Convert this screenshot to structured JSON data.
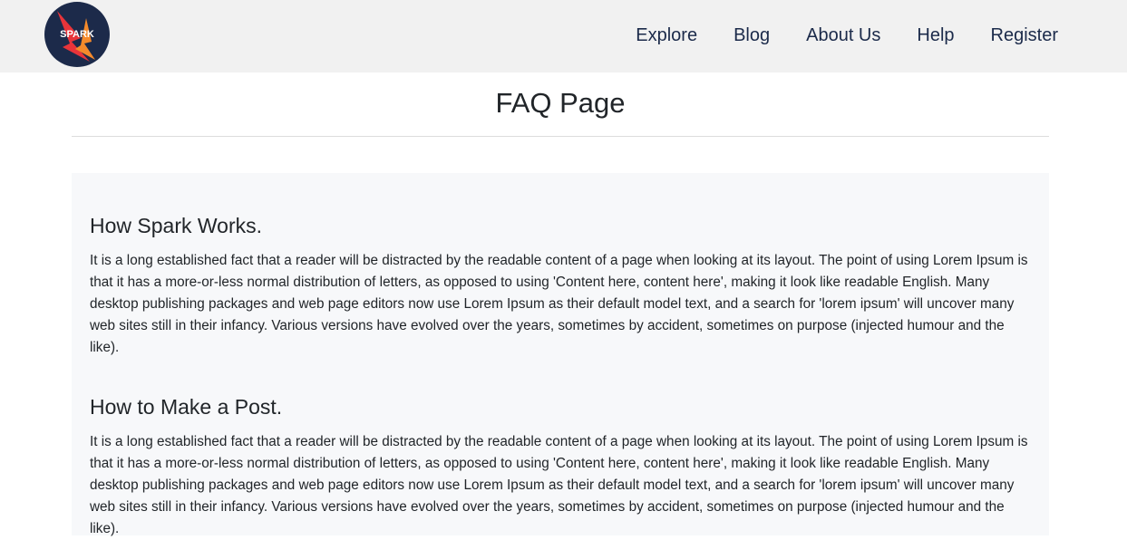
{
  "header": {
    "logo_text": "SPARK",
    "nav": [
      {
        "label": "Explore"
      },
      {
        "label": "Blog"
      },
      {
        "label": "About Us"
      },
      {
        "label": "Help"
      },
      {
        "label": "Register"
      }
    ]
  },
  "page": {
    "title": "FAQ Page"
  },
  "faq": [
    {
      "question": "How Spark Works.",
      "answer": "It is a long established fact that a reader will be distracted by the readable content of a page when looking at its layout. The point of using Lorem Ipsum is that it has a more-or-less normal distribution of letters, as opposed to using 'Content here, content here', making it look like readable English. Many desktop publishing packages and web page editors now use Lorem Ipsum as their default model text, and a search for 'lorem ipsum' will uncover many web sites still in their infancy. Various versions have evolved over the years, sometimes by accident, sometimes on purpose (injected humour and the like)."
    },
    {
      "question": "How to Make a Post.",
      "answer": "It is a long established fact that a reader will be distracted by the readable content of a page when looking at its layout. The point of using Lorem Ipsum is that it has a more-or-less normal distribution of letters, as opposed to using 'Content here, content here', making it look like readable English. Many desktop publishing packages and web page editors now use Lorem Ipsum as their default model text, and a search for 'lorem ipsum' will uncover many web sites still in their infancy. Various versions have evolved over the years, sometimes by accident, sometimes on purpose (injected humour and the like)."
    }
  ],
  "colors": {
    "navbar_bg": "#f1f1f1",
    "nav_text": "#1b2a4a",
    "panel_bg": "#f7f8fa",
    "logo_circle": "#1c2a4a",
    "logo_flame_red": "#e8343a",
    "logo_flame_orange": "#f58a2b"
  }
}
